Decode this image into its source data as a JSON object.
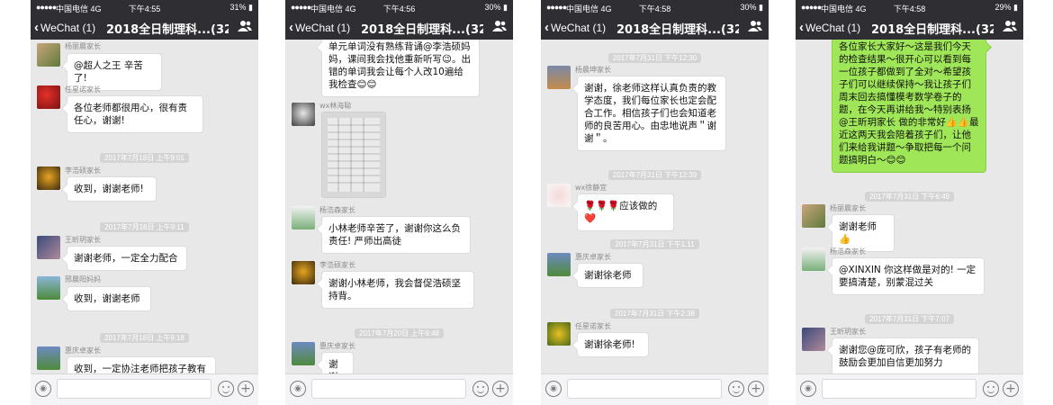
{
  "phones": [
    {
      "status": {
        "carrier": "中国电信",
        "net": "4G",
        "time": "下午4:55",
        "battery": "31%"
      },
      "nav": {
        "back": "WeChat (1)",
        "title": "2018全日制理科...",
        "count": "(32)"
      },
      "messages": [
        {
          "sender": "杨丽晨家长",
          "text": "@超人之王 辛苦了!"
        },
        {
          "sender": "任星诺家长",
          "text": "各位老师都很用心，很有责任心，谢谢!"
        },
        {
          "timestamp": "2017年7月18日 上午9:01"
        },
        {
          "sender": "李浩硕家长",
          "text": "收到，谢谢老师!"
        },
        {
          "timestamp": "2017年7月18日 上午9:11"
        },
        {
          "sender": "王昕玥家长",
          "text": "谢谢老师，一定全力配合"
        },
        {
          "sender": "邢晨阳妈妈",
          "text": "收到，谢谢老师"
        },
        {
          "timestamp": "2017年7月18日 上午9:18"
        },
        {
          "sender": "惠庆卓家长",
          "text": "收到，一定协注老师把孩子教有"
        }
      ]
    },
    {
      "status": {
        "carrier": "中国电信",
        "net": "4G",
        "time": "下午4:56",
        "battery": "30%"
      },
      "nav": {
        "back": "WeChat (1)",
        "title": "2018全日制理科...",
        "count": "(32)"
      },
      "messages": [
        {
          "text": "单元单词没有熟练背诵@李浩硕妈妈，课间我会找他重新听写😉。出错的单词我会让每个人改10遍给我检查😊😊"
        },
        {
          "sender": "wx林海聪",
          "image": true
        },
        {
          "sender": "杨浩森家长",
          "text": "小林老师辛苦了，谢谢你这么负责任! 严师出高徒"
        },
        {
          "sender": "李浩硕家长",
          "text": "谢谢小林老师，我会督促浩硕坚持背。"
        },
        {
          "timestamp": "2017年7月20日 上午9:48"
        },
        {
          "sender": "惠庆卓家长",
          "text": "谢谢"
        }
      ]
    },
    {
      "status": {
        "carrier": "中国电信",
        "net": "4G",
        "time": "下午4:58",
        "battery": "30%"
      },
      "nav": {
        "back": "WeChat (1)",
        "title": "2018全日制理科...",
        "count": "(32)"
      },
      "messages": [
        {
          "timestamp": "2017年7月31日 下午12:30"
        },
        {
          "sender": "杨晨坤家长",
          "text": "谢谢，徐老师这样认真负责的教学态度，我们每位家长也定会配合工作。相信孩子们也会知道老师的良苦用心。由忠地说声＂谢谢＂。"
        },
        {
          "timestamp": "2017年7月31日 下午12:39"
        },
        {
          "sender": "wx徐静宜",
          "text": "🌹🌹🌹应该做的❤️"
        },
        {
          "timestamp": "2017年7月31日 下午1:11"
        },
        {
          "sender": "惠庆卓家长",
          "text": "谢谢徐老师"
        },
        {
          "timestamp": "2017年7月31日 下午2:38"
        },
        {
          "sender": "任星诺家长",
          "text": "谢谢徐老师!"
        }
      ]
    },
    {
      "status": {
        "carrier": "中国电信",
        "net": "4G",
        "time": "下午4:58",
        "battery": "29%"
      },
      "nav": {
        "back": "WeChat (1)",
        "title": "2018全日制理科...",
        "count": "(32)"
      },
      "messages": [
        {
          "self": true,
          "text": "各位家长大家好～这是我们今天的检查结果～很开心可以看到每一位孩子都做到了全对～希望孩子们可以继续保持～我让孩子们周末回去搞懂模考数学卷子的题，在今天再讲给我～特别表扬@王昕玥家长 做的非常好👍👍最近这两天我会陪着孩子们，让他们来给我讲题～争取把每一个问题搞明白～😊😊"
        },
        {
          "timestamp": "2017年7月31日 下午6:49"
        },
        {
          "sender": "杨丽晨家长",
          "text": "谢谢老师👍"
        },
        {
          "sender": "杨浩森家长",
          "text": "@XINXIN 你这样做是对的! 一定要搞清楚，别蒙混过关"
        },
        {
          "timestamp": "2017年7月31日 下午7:07"
        },
        {
          "sender": "王昕玥家长",
          "text": "谢谢您@庞可欣，孩子有老师的鼓励会更加自信更加努力"
        }
      ]
    }
  ],
  "icon_names": [
    "back-chevron-icon",
    "group-members-icon",
    "voice-icon",
    "emoji-icon",
    "plus-icon",
    "signal-icon",
    "battery-icon"
  ],
  "colors": {
    "navbar": "#2e2e33",
    "chat_bg": "#e8e8e8",
    "self_bubble": "#9fe658",
    "timestamp_bg": "#d4d4d4"
  }
}
